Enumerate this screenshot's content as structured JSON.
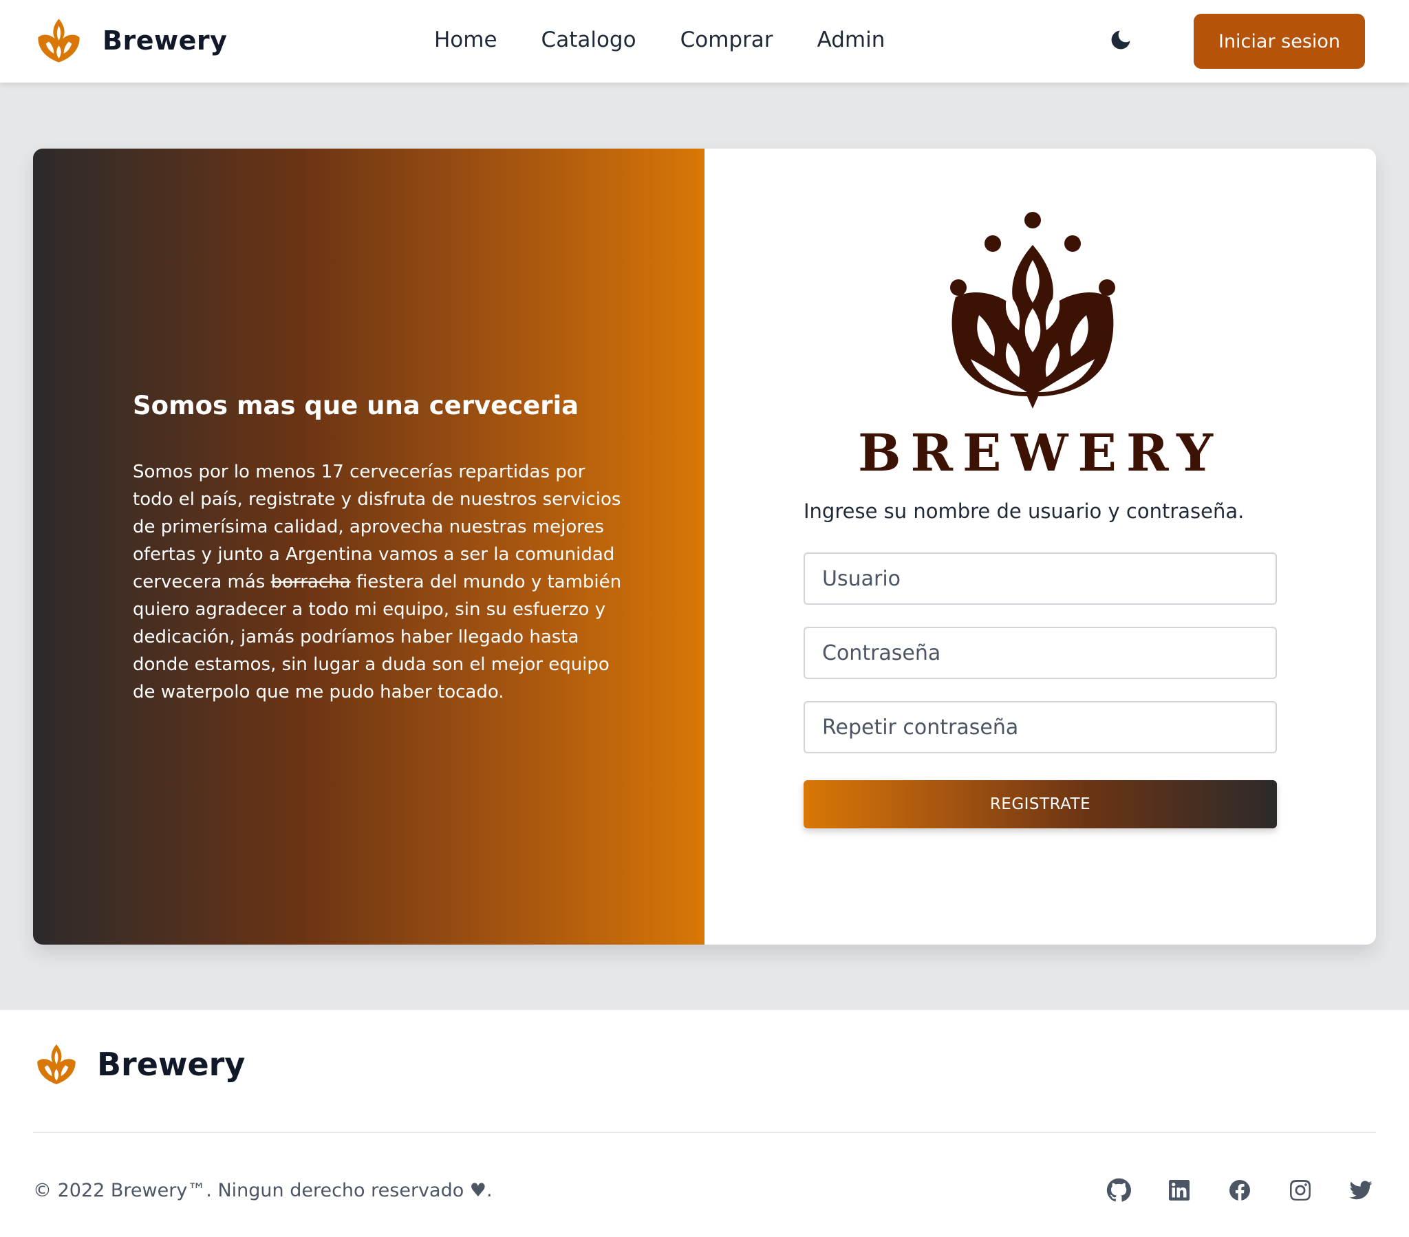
{
  "header": {
    "brand": "Brewery",
    "nav": [
      "Home",
      "Catalogo",
      "Comprar",
      "Admin"
    ],
    "theme_icon": "moon-icon",
    "login_label": "Iniciar sesion"
  },
  "promo": {
    "title": "Somos mas que una cerveceria",
    "text_before": "Somos por lo menos 17 cervecerías repartidas por todo el país, registrate y disfruta de nuestros servicios de primerísima calidad, aprovecha nuestras mejores ofertas y junto a Argentina vamos a ser la comunidad cervecera más ",
    "text_struck": "borracha",
    "text_after": " fiestera del mundo y también quiero agradecer a todo mi equipo, sin su esfuerzo y dedicación, jamás podríamos haber llegado hasta donde estamos, sin lugar a duda son el mejor equipo de waterpolo que me pudo haber tocado."
  },
  "form": {
    "logo_word": "BREWERY",
    "intro": "Ingrese su nombre de usuario y contraseña.",
    "user_placeholder": "Usuario",
    "password_placeholder": "Contraseña",
    "repeat_placeholder": "Repetir contraseña",
    "register_label": "REGISTRATE"
  },
  "footer": {
    "brand": "Brewery",
    "copyright": "© 2022 Brewery™. Ningun derecho reservado ♥.",
    "socials": [
      "github-icon",
      "linkedin-icon",
      "facebook-icon",
      "instagram-icon",
      "twitter-icon"
    ]
  },
  "colors": {
    "accent": "#b45309",
    "accent_light": "#d97706",
    "dark": "#2c2a2b",
    "logo_brown": "#3b1204",
    "page_bg": "#e5e7eb"
  }
}
